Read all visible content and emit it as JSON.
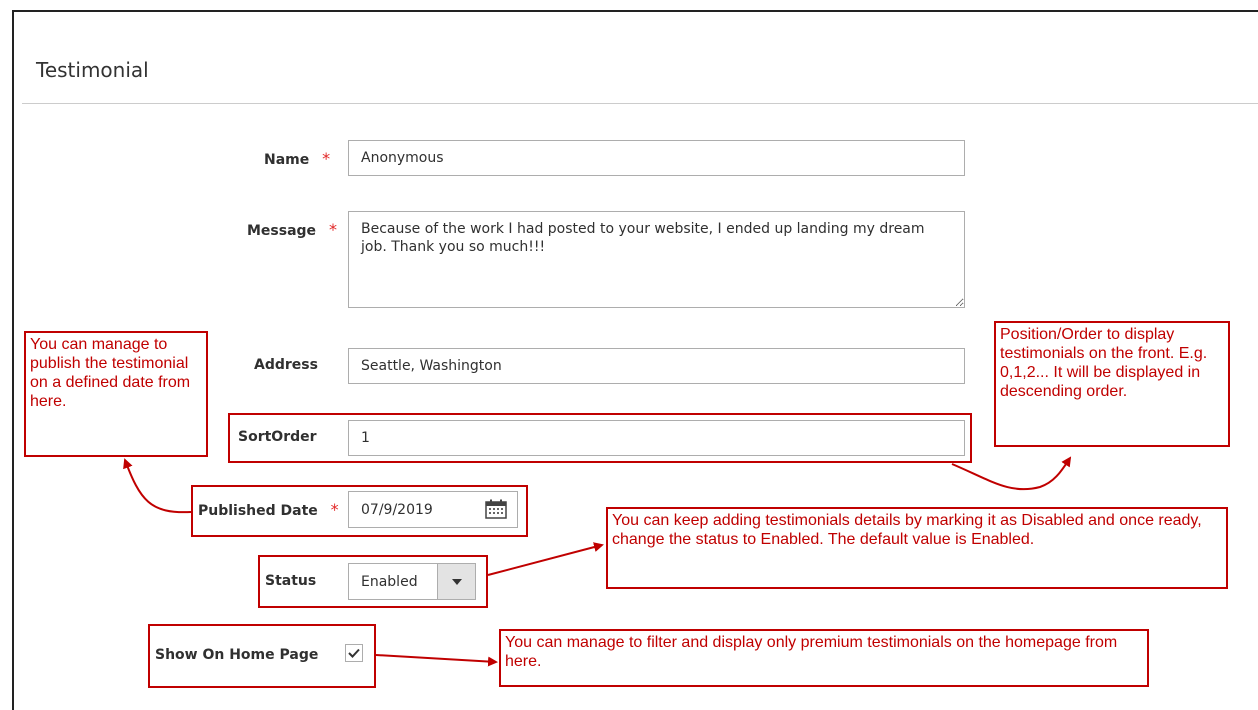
{
  "section": {
    "title": "Testimonial"
  },
  "form": {
    "name": {
      "label": "Name",
      "required": "*",
      "value": "Anonymous"
    },
    "message": {
      "label": "Message",
      "required": "*",
      "value": "Because of the work I had posted to your website, I ended up landing my dream job. Thank you so much!!!"
    },
    "address": {
      "label": "Address",
      "value": "Seattle, Washington"
    },
    "sort_order": {
      "label": "SortOrder",
      "value": "1"
    },
    "published_date": {
      "label": "Published Date",
      "required": "*",
      "value": "07/9/2019",
      "icon": "calendar-icon"
    },
    "status": {
      "label": "Status",
      "value": "Enabled",
      "icon": "dropdown-arrow-icon"
    },
    "show_on_home": {
      "label": "Show On Home Page",
      "checked": true,
      "icon": "checkmark-icon"
    }
  },
  "annotations": {
    "publish": "You can manage to publish the testimonial on a defined date from here.",
    "sort_order": "Position/Order to display testimonials on the front. E.g. 0,1,2... It will be displayed in descending order.",
    "status": "You can keep adding testimonials details by marking it as Disabled and once ready, change the status to Enabled. The default value is Enabled.",
    "home_page": "You can manage to filter and display only premium testimonials on the homepage from here."
  },
  "colors": {
    "annotation": "#c00000",
    "required": "#e22626",
    "text": "#303030"
  }
}
